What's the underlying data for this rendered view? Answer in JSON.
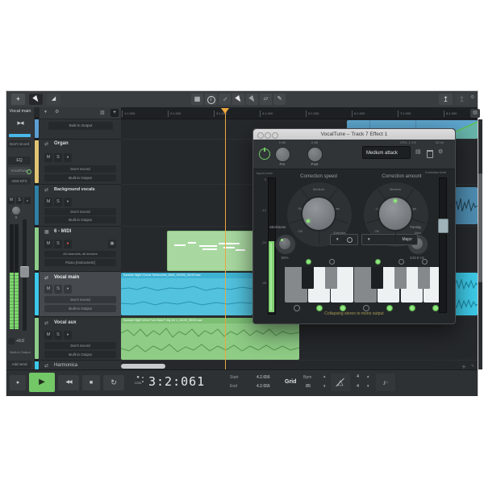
{
  "toolbar": {
    "icons_left": [
      "move-tool",
      "pointer-tool",
      "fade-tool"
    ],
    "icons_center": [
      "grid-tool",
      "info-tool",
      "expand-tool",
      "select-tool-alt",
      "select-tool",
      "eraser-tool",
      "pencil-tool"
    ],
    "icons_right": [
      "publish-tool",
      "share-tool",
      "settings-tool"
    ]
  },
  "inspector": {
    "title": "Vocal main",
    "record_mode": "Don't record",
    "eq": "EQ",
    "plugin_slot": "VocalTune",
    "add_fx": "ADD EFX",
    "mute": "M",
    "solo": "S",
    "pan_value": "0",
    "gain_value": "+0.0",
    "output": "Built-in Output",
    "add_send": "Add send"
  },
  "tracks": [
    {
      "name": "",
      "color": "#5b9fd3",
      "output": "Built-in Output"
    },
    {
      "name": "Organ",
      "color": "#e0c472",
      "mute": "M",
      "solo": "S",
      "record_mode": "Don't record",
      "output": "Built-in Output"
    },
    {
      "name": "Background vocals",
      "color": "#2f7fa6",
      "mute": "M",
      "solo": "S",
      "record_mode": "Don't record",
      "output": "Built-in Output"
    },
    {
      "name": "6 - MIDI",
      "color": "#8ccc8a",
      "mute": "M",
      "solo": "S",
      "input": "All channels, all devices",
      "instrument": "Piano [Instrument]"
    },
    {
      "name": "Vocal main",
      "color": "#3cc8ea",
      "mute": "M",
      "solo": "S",
      "record_mode": "Don't record",
      "output": "Built-in Output"
    },
    {
      "name": "Vocal aux",
      "color": "#8ccc8a",
      "mute": "M",
      "solo": "S",
      "record_mode": "Don't record",
      "output": "Built-in Output"
    },
    {
      "name": "Harmonica",
      "color": "#3cc8ea"
    }
  ],
  "ruler": {
    "labels": [
      "1:1.000",
      "2:1.000",
      "3:1.000",
      "4:1.000",
      "5:1.000",
      "6:1.000",
      "7:1.000",
      "8:1.000"
    ]
  },
  "clips": {
    "vocal_main": "Karaoke Night Chorus Tambourine_64bit_192000_44100.wav",
    "vocal_aux": "Karaoke Night Verse Foxx Bass F-ing ver 1_44100_96000.wav"
  },
  "plugin": {
    "title": "VocalTune – Track 7 Effect 1",
    "pre_db": "0 dB",
    "post_db": "0 dB",
    "pre": "Pre",
    "post": "Post",
    "preset": "Medium attack",
    "cpu": "CPU: 1.1%",
    "bits": "32 bit",
    "input_level": "Input Level",
    "correction_speed": "Correction speed",
    "correction_amount": "Correction amount",
    "speed_labels": [
      "Off",
      "Slow",
      "Medium",
      "Fast",
      "Extreme"
    ],
    "amount_labels": [
      "Off",
      "Low",
      "Medium",
      "High",
      "Max"
    ],
    "stickiness": "Stickiness",
    "stickiness_value": "50%",
    "tuning": "Tuning",
    "tuning_value": "443.5 Hz",
    "scale": "Major",
    "correction_level": "Correction level",
    "footer": "Collapsing stereo to mono output",
    "meter_ticks": [
      "0",
      "-12",
      "-24",
      "-48"
    ],
    "keyboard": {
      "white": [
        "gray",
        "white",
        "white",
        "gray",
        "white",
        "white",
        "white"
      ],
      "black": [
        "dark",
        "gray",
        "dark",
        "gray",
        "gray"
      ],
      "top_dots": [
        1,
        0,
        1,
        0,
        0
      ],
      "bottom_dots": [
        0,
        1,
        1,
        0,
        1,
        1,
        1
      ]
    }
  },
  "transport": {
    "time": "3:2:061",
    "start_label": "Start",
    "start": "4.2.656",
    "end_label": "End",
    "end": "4.2.656",
    "grid": "Grid",
    "bpm_label": "Bpm",
    "bpm": "85",
    "ts_top": "4",
    "ts_bottom": "4",
    "count": "1234"
  }
}
